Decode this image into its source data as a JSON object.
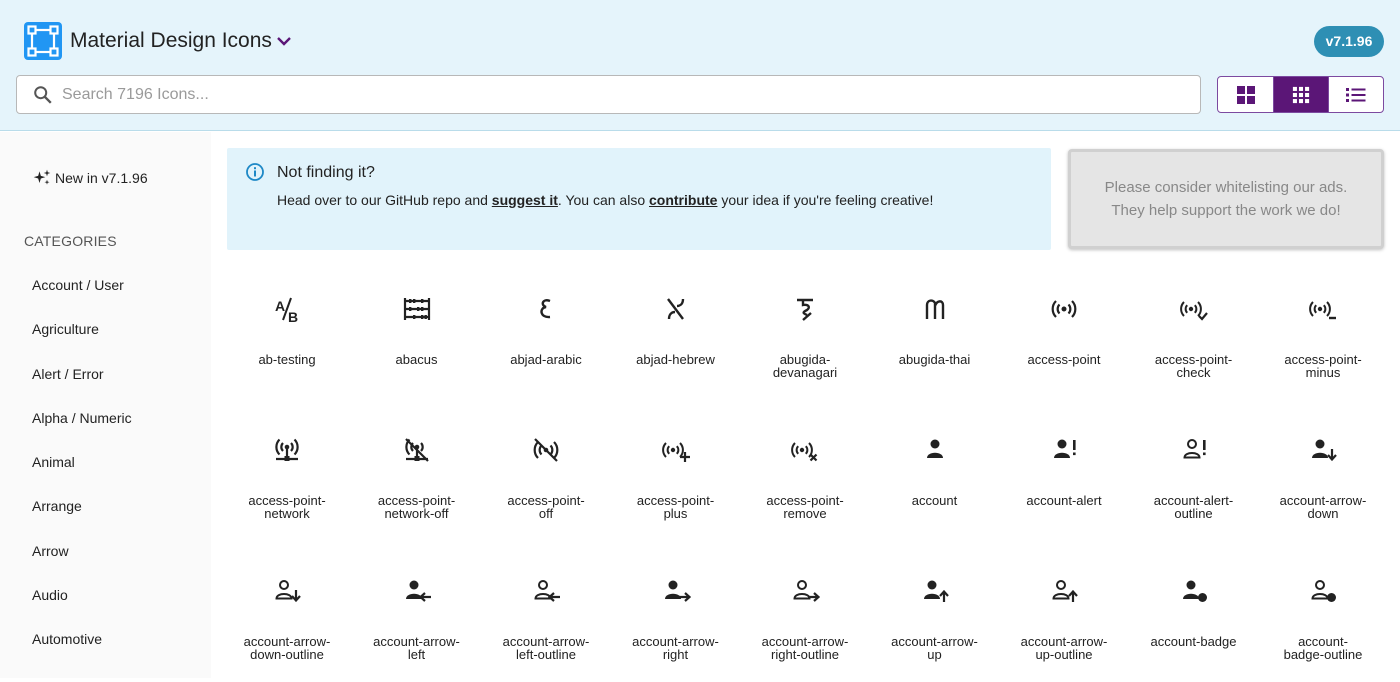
{
  "app": {
    "title": "Material Design Icons",
    "version": "v7.1.96",
    "brand_color": "#2196f3",
    "accent_color": "#5b1677"
  },
  "search": {
    "placeholder": "Search 7196 Icons...",
    "value": ""
  },
  "view_modes": [
    {
      "icon": "view-large-grid-icon",
      "active": false
    },
    {
      "icon": "view-small-grid-icon",
      "active": true
    },
    {
      "icon": "view-list-icon",
      "active": false
    }
  ],
  "sidebar": {
    "new_label": "New in v7.1.96",
    "categories_heading": "CATEGORIES",
    "categories": [
      "Account / User",
      "Agriculture",
      "Alert / Error",
      "Alpha / Numeric",
      "Animal",
      "Arrange",
      "Arrow",
      "Audio",
      "Automotive"
    ]
  },
  "info": {
    "title": "Not finding it?",
    "text_before": "Head over to our GitHub repo and ",
    "link1": "suggest it",
    "text_middle": ". You can also ",
    "link2": "contribute",
    "text_after": " your idea if you're feeling creative!"
  },
  "ad": {
    "line1": "Please consider whitelisting our ads.",
    "line2": "They help support the work we do!"
  },
  "icons": [
    {
      "name": "ab-testing",
      "label": "ab-testing"
    },
    {
      "name": "abacus",
      "label": "abacus"
    },
    {
      "name": "abjad-arabic",
      "label": "abjad-arabic"
    },
    {
      "name": "abjad-hebrew",
      "label": "abjad-hebrew"
    },
    {
      "name": "abugida-devanagari",
      "label": "abugida-\ndevanagari"
    },
    {
      "name": "abugida-thai",
      "label": "abugida-thai"
    },
    {
      "name": "access-point",
      "label": "access-point"
    },
    {
      "name": "access-point-check",
      "label": "access-point-\ncheck"
    },
    {
      "name": "access-point-minus",
      "label": "access-point-\nminus"
    },
    {
      "name": "access-point-network",
      "label": "access-point-\nnetwork"
    },
    {
      "name": "access-point-network-off",
      "label": "access-point-\nnetwork-off"
    },
    {
      "name": "access-point-off",
      "label": "access-point-\noff"
    },
    {
      "name": "access-point-plus",
      "label": "access-point-\nplus"
    },
    {
      "name": "access-point-remove",
      "label": "access-point-\nremove"
    },
    {
      "name": "account",
      "label": "account"
    },
    {
      "name": "account-alert",
      "label": "account-alert"
    },
    {
      "name": "account-alert-outline",
      "label": "account-alert-\noutline"
    },
    {
      "name": "account-arrow-down",
      "label": "account-arrow-\ndown"
    },
    {
      "name": "account-arrow-down-outline",
      "label": "account-arrow-\ndown-outline"
    },
    {
      "name": "account-arrow-left",
      "label": "account-arrow-\nleft"
    },
    {
      "name": "account-arrow-left-outline",
      "label": "account-arrow-\nleft-outline"
    },
    {
      "name": "account-arrow-right",
      "label": "account-arrow-\nright"
    },
    {
      "name": "account-arrow-right-outline",
      "label": "account-arrow-\nright-outline"
    },
    {
      "name": "account-arrow-up",
      "label": "account-arrow-\nup"
    },
    {
      "name": "account-arrow-up-outline",
      "label": "account-arrow-\nup-outline"
    },
    {
      "name": "account-badge",
      "label": "account-badge"
    },
    {
      "name": "account-badge-outline",
      "label": "account-\nbadge-outline"
    }
  ]
}
